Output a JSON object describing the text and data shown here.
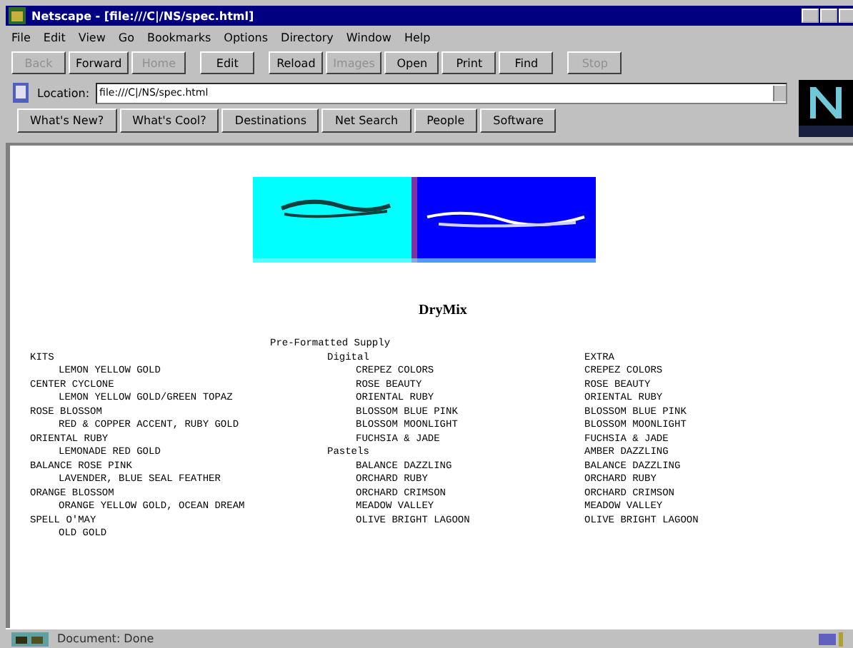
{
  "window": {
    "title": "Netscape - [file:///C|/NS/spec.html]"
  },
  "menu": [
    "File",
    "Edit",
    "View",
    "Go",
    "Bookmarks",
    "Options",
    "Directory",
    "Window",
    "Help"
  ],
  "toolbar": [
    {
      "label": "Back",
      "disabled": true
    },
    {
      "label": "Forward",
      "disabled": false
    },
    {
      "label": "Home",
      "disabled": true
    },
    {
      "label": "Edit",
      "disabled": false
    },
    {
      "label": "Reload",
      "disabled": false
    },
    {
      "label": "Images",
      "disabled": true
    },
    {
      "label": "Open",
      "disabled": false
    },
    {
      "label": "Print",
      "disabled": false
    },
    {
      "label": "Find",
      "disabled": false
    },
    {
      "label": "Stop",
      "disabled": true
    }
  ],
  "location": {
    "label": "Location:",
    "value": "file:///C|/NS/spec.html"
  },
  "directory_buttons": [
    "What's New?",
    "What's Cool?",
    "Destinations",
    "Net Search",
    "People",
    "Software"
  ],
  "page": {
    "banner": {
      "kind": "picture"
    },
    "title": "DryMix",
    "heading": "Pre-Formatted Supply",
    "columns": [
      [
        {
          "text": "KITS",
          "children": [
            {
              "text": "LEMON YELLOW GOLD"
            }
          ]
        },
        {
          "text": "CENTER CYCLONE",
          "children": [
            {
              "text": "LEMON YELLOW GOLD/GREEN TOPAZ"
            }
          ]
        },
        {
          "text": "ROSE BLOSSOM",
          "children": [
            {
              "text": "RED & COPPER ACCENT, RUBY GOLD"
            }
          ]
        },
        {
          "text": "ORIENTAL RUBY",
          "children": [
            {
              "text": "LEMONADE RED GOLD"
            }
          ]
        },
        {
          "text": "BALANCE ROSE PINK",
          "children": [
            {
              "text": "LAVENDER, BLUE SEAL FEATHER"
            }
          ]
        },
        {
          "text": "ORANGE BLOSSOM",
          "children": [
            {
              "text": "ORANGE YELLOW GOLD, OCEAN DREAM"
            }
          ]
        },
        {
          "text": "SPELL O'MAY",
          "children": [
            {
              "text": "OLD GOLD"
            }
          ]
        }
      ],
      [
        {
          "text": "Digital",
          "children": [
            {
              "text": "CREPEZ COLORS"
            },
            {
              "text": "ROSE BEAUTY"
            },
            {
              "text": "ORIENTAL RUBY"
            },
            {
              "text": "BLOSSOM BLUE PINK"
            },
            {
              "text": "BLOSSOM MOONLIGHT"
            },
            {
              "text": "FUCHSIA & JADE"
            }
          ]
        },
        {
          "text": "Pastels",
          "children": [
            {
              "text": "BALANCE DAZZLING"
            },
            {
              "text": "ORCHARD RUBY"
            },
            {
              "text": "ORCHARD CRIMSON"
            },
            {
              "text": "MEADOW VALLEY"
            },
            {
              "text": "OLIVE BRIGHT LAGOON"
            }
          ]
        }
      ],
      [
        {
          "text": "EXTRA"
        },
        {
          "text": "CREPEZ COLORS"
        },
        {
          "text": "ROSE BEAUTY"
        },
        {
          "text": "ORIENTAL RUBY"
        },
        {
          "text": "BLOSSOM BLUE PINK"
        },
        {
          "text": "BLOSSOM MOONLIGHT"
        },
        {
          "text": "FUCHSIA & JADE"
        },
        {
          "text": "AMBER DAZZLING"
        },
        {
          "text": "BALANCE DAZZLING"
        },
        {
          "text": "ORCHARD RUBY"
        },
        {
          "text": "ORCHARD CRIMSON"
        },
        {
          "text": "MEADOW VALLEY"
        },
        {
          "text": "OLIVE BRIGHT LAGOON"
        }
      ]
    ]
  },
  "status_bar": {
    "text": "Document: Done"
  }
}
